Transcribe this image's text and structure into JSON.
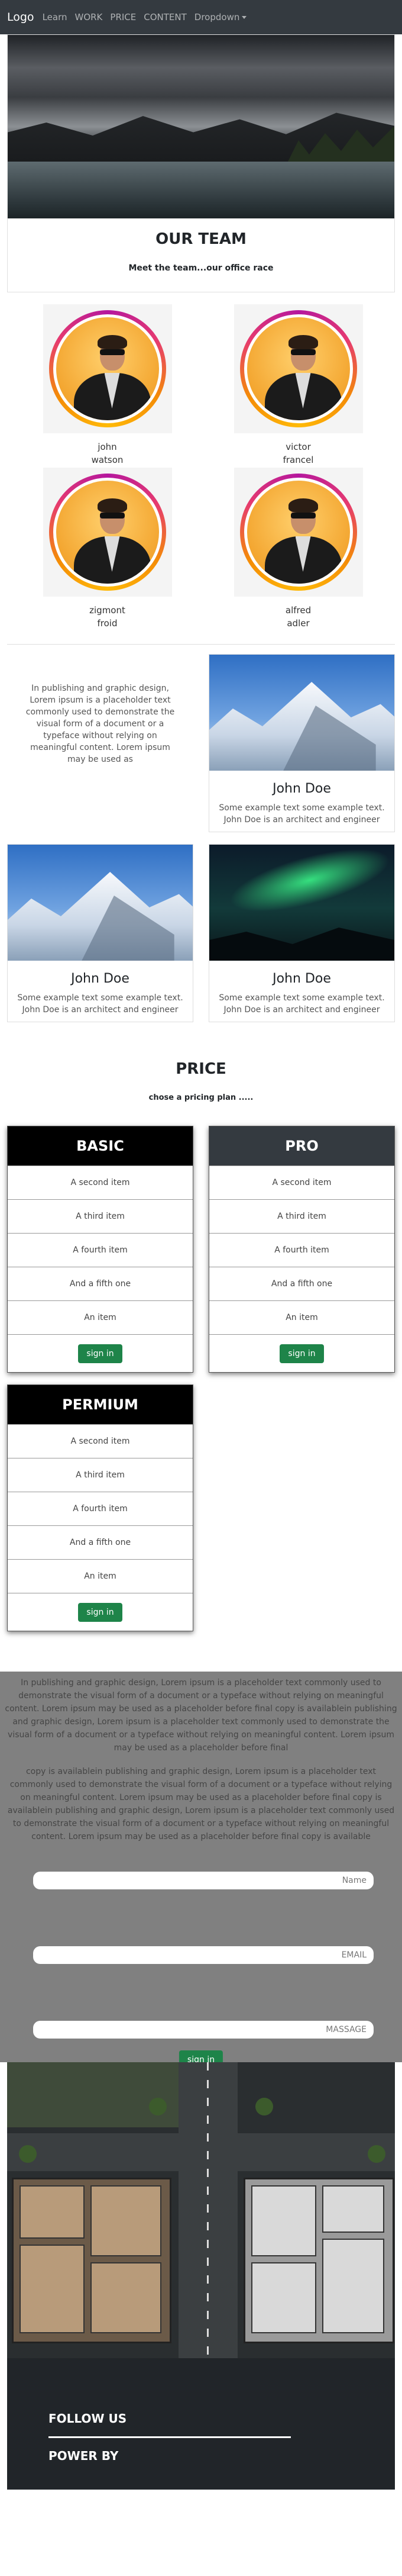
{
  "nav": {
    "logo": "Logo",
    "links": [
      "Learn",
      "WORK",
      "PRICE",
      "CONTENT"
    ],
    "dropdown": "Dropdown"
  },
  "hero": {
    "title": "OUR TEAM",
    "subtitle": "Meet the team...our office race"
  },
  "team": [
    {
      "first": "john",
      "last": "watson"
    },
    {
      "first": "victor",
      "last": "francel"
    },
    {
      "first": "zigmont",
      "last": "froid"
    },
    {
      "first": "alfred",
      "last": "adler"
    }
  ],
  "intro_text": "In publishing and graphic design, Lorem ipsum is a placeholder text commonly used to demonstrate the visual form of a document or a typeface without relying on meaningful content. Lorem ipsum may be used as",
  "cards": [
    {
      "title": "John Doe",
      "text": "Some example text some example text. John Doe is an architect and engineer"
    },
    {
      "title": "John Doe",
      "text": "Some example text some example text. John Doe is an architect and engineer"
    },
    {
      "title": "John Doe",
      "text": "Some example text some example text. John Doe is an architect and engineer"
    }
  ],
  "pricing": {
    "title": "PRICE",
    "subtitle": "chose a pricing plan .....",
    "plans": [
      {
        "name": "BASIC",
        "header_color": "#000000",
        "items": [
          "A second item",
          "A third item",
          "A fourth item",
          "And a fifth one",
          "An item"
        ],
        "button": "sign in"
      },
      {
        "name": "PRO",
        "header_color": "#343a40",
        "items": [
          "A second item",
          "A third item",
          "A fourth item",
          "And a fifth one",
          "An item"
        ],
        "button": "sign in"
      },
      {
        "name": "PERMIUM",
        "header_color": "#000000",
        "items": [
          "A second item",
          "A third item",
          "A fourth item",
          "And a fifth one",
          "An item"
        ],
        "button": "sign in"
      }
    ]
  },
  "contact": {
    "paragraph1": "In publishing and graphic design, Lorem ipsum is a placeholder text commonly used to demonstrate the visual form of a document or a typeface without relying on meaningful content. Lorem ipsum may be used as a placeholder before final copy is availablein publishing and graphic design, Lorem ipsum is a placeholder text commonly used to demonstrate the visual form of a document or a typeface without relying on meaningful content. Lorem ipsum may be used as a placeholder before final",
    "paragraph2": "copy is availablein publishing and graphic design, Lorem ipsum is a placeholder text commonly used to demonstrate the visual form of a document or a typeface without relying on meaningful content. Lorem ipsum may be used as a placeholder before final copy is availablein publishing and graphic design, Lorem ipsum is a placeholder text commonly used to demonstrate the visual form of a document or a typeface without relying on meaningful content. Lorem ipsum may be used as a placeholder before final copy is available",
    "name_placeholder": "Name",
    "email_placeholder": "EMAIL",
    "message_placeholder": "MASSAGE",
    "send_button": "sign in"
  },
  "footer": {
    "follow": "FOLLOW US",
    "power": "POWER BY"
  }
}
